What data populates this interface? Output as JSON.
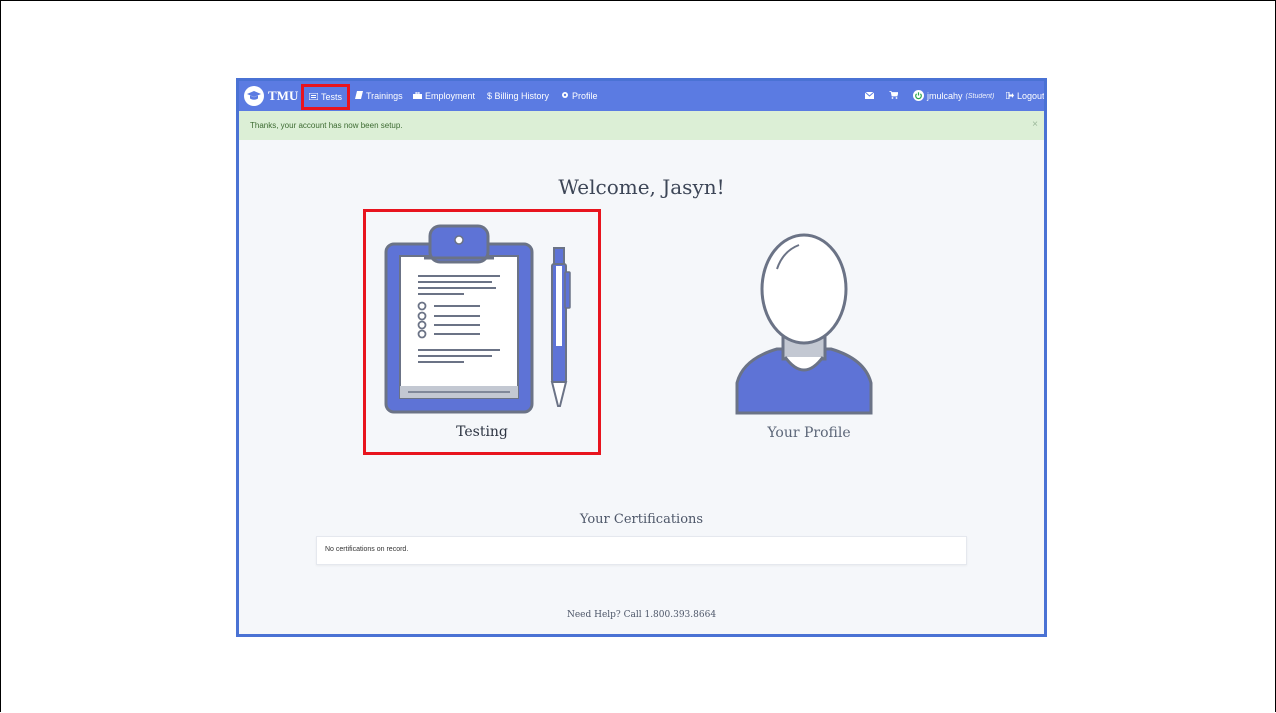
{
  "nav": {
    "brand": "TMU",
    "tests": "Tests",
    "trainings": "Trainings",
    "employment": "Employment",
    "billing": "$ Billing History",
    "profile": "Profile",
    "username": "jmulcahy",
    "role": "(Student)",
    "logout": "Logout"
  },
  "alert": {
    "message": "Thanks, your account has now been setup.",
    "close": "×"
  },
  "welcome": "Welcome, Jasyn!",
  "cards": {
    "testing": "Testing",
    "profile": "Your Profile"
  },
  "certifications": {
    "title": "Your Certifications",
    "empty": "No certifications on record."
  },
  "help": "Need Help? Call 1.800.393.8664",
  "icons": {
    "brand": "graduation-cap-icon",
    "tests": "list-icon",
    "trainings": "book-icon",
    "employment": "briefcase-icon",
    "profile": "gear-icon",
    "mail": "envelope-icon",
    "cart": "cart-icon",
    "user": "power-icon",
    "logout": "sign-out-icon"
  },
  "colors": {
    "navbar": "#5b7be2",
    "highlight": "#e8141e",
    "alert_bg": "#dcefd6",
    "accent": "#5e73d6"
  }
}
